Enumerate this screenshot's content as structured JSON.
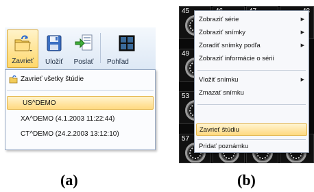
{
  "panel_a": {
    "toolbar": {
      "buttons": [
        {
          "label": "Zavrieť",
          "icon": "folder-open-icon"
        },
        {
          "label": "Uložiť",
          "icon": "floppy-disk-icon"
        },
        {
          "label": "Poslať",
          "icon": "send-icon"
        },
        {
          "label": "Pohľad",
          "icon": "layout-grid-icon"
        }
      ]
    },
    "dropdown": {
      "close_all": "Zavrieť všetky štúdie",
      "studies": [
        "US^DEMO",
        "XA^DEMO (4.1.2003 11:22:44)",
        "CT^DEMO (24.2.2003 13:12:10)"
      ]
    },
    "caption": "(a)"
  },
  "panel_b": {
    "thumbnails": [
      "45",
      "46",
      "47",
      "48",
      "49",
      "53",
      "57"
    ],
    "context_menu": {
      "items": [
        {
          "label": "Zobraziť série",
          "submenu": true
        },
        {
          "label": "Zobraziť snímky",
          "submenu": true
        },
        {
          "label": "Zoradiť snímky podľa",
          "submenu": true
        },
        {
          "label": "Zobraziť informácie o sérii",
          "submenu": false
        },
        {
          "label": "Vložiť snímku",
          "submenu": true
        },
        {
          "label": "Zmazať snímku",
          "submenu": false
        },
        {
          "label": "Zavrieť štúdiu",
          "submenu": false
        },
        {
          "label": "Pridať poznámku",
          "submenu": false
        }
      ],
      "submenu_arrow": "▶"
    },
    "caption": "(b)"
  },
  "colors": {
    "highlight_top": "#fff4cf",
    "highlight_bottom": "#ffd980",
    "toolbar_bg": "#dde8f5"
  }
}
